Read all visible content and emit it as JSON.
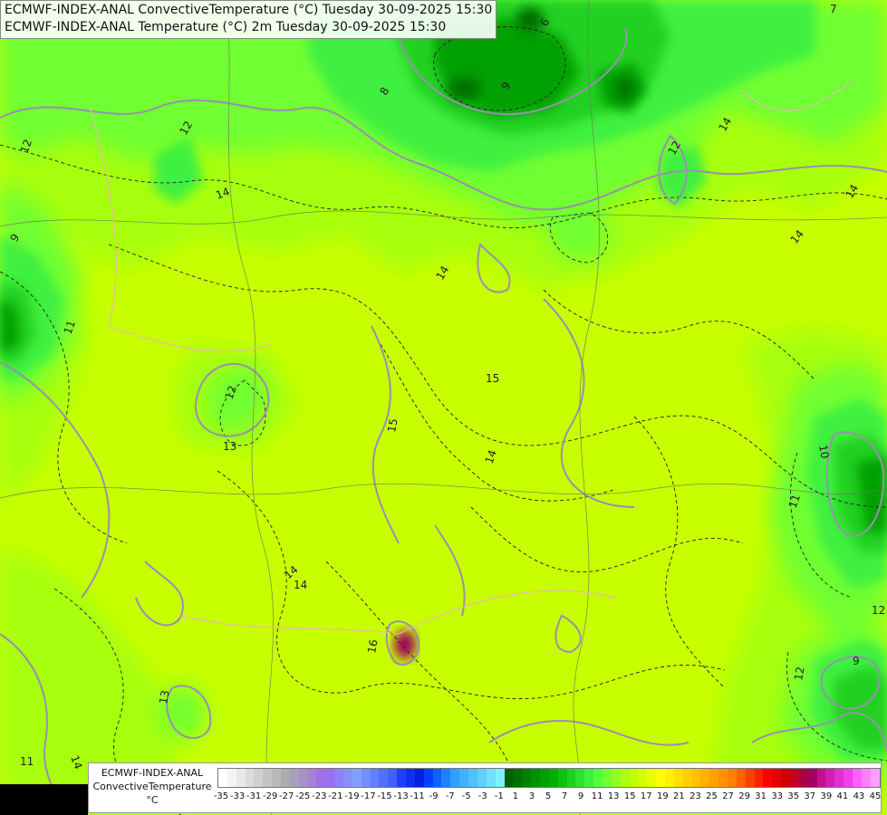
{
  "titles": {
    "line1": "ECMWF-INDEX-ANAL ConvectiveTemperature (°C) Tuesday 30-09-2025 15:30",
    "line2": "ECMWF-INDEX-ANAL Temperature (°C) 2m Tuesday 30-09-2025 15:30"
  },
  "legend": {
    "line1": "ECMWF-INDEX-ANAL",
    "line2": "ConvectiveTemperature",
    "line3": "°C",
    "tick_labels": [
      "-35",
      "-33",
      "-31",
      "-29",
      "-27",
      "-25",
      "-23",
      "-21",
      "-19",
      "-17",
      "-15",
      "-13",
      "-11",
      "-9",
      "-7",
      "-5",
      "-3",
      "-1",
      "1",
      "3",
      "5",
      "7",
      "9",
      "11",
      "13",
      "15",
      "17",
      "19",
      "21",
      "23",
      "25",
      "27",
      "29",
      "31",
      "33",
      "35",
      "37",
      "39",
      "41",
      "43",
      "45"
    ],
    "colors": [
      "#ffffff",
      "#f4f4f4",
      "#e8e8e8",
      "#dcdcdc",
      "#d0d0d0",
      "#c4c4c4",
      "#b8b8b8",
      "#acacac",
      "#a8a0b8",
      "#a890c8",
      "#a880d8",
      "#a070e8",
      "#9870f0",
      "#9080f8",
      "#8890f8",
      "#80a0ff",
      "#7090ff",
      "#6080ff",
      "#5070ff",
      "#4060ff",
      "#2040ff",
      "#1030f0",
      "#0020e0",
      "#0040ff",
      "#1060ff",
      "#2080ff",
      "#30a0ff",
      "#40b0ff",
      "#50c0ff",
      "#60d0ff",
      "#70e0ff",
      "#80f0ff",
      "#006000",
      "#007000",
      "#008000",
      "#009000",
      "#00a000",
      "#00b000",
      "#10c010",
      "#20d020",
      "#30e030",
      "#40f040",
      "#50ff40",
      "#70ff30",
      "#90ff20",
      "#a8ff10",
      "#c0ff00",
      "#d4ff00",
      "#e8ff00",
      "#ffff00",
      "#fff000",
      "#ffe000",
      "#ffd000",
      "#ffc000",
      "#ffb000",
      "#ffa000",
      "#ff9000",
      "#ff8000",
      "#ff6000",
      "#ff4000",
      "#ff2000",
      "#ff0000",
      "#e80000",
      "#d00000",
      "#c00020",
      "#b00040",
      "#a00060",
      "#c01090",
      "#d020b0",
      "#e030d0",
      "#f040e8",
      "#ff60ff",
      "#ff80ff",
      "#ffa0ff"
    ]
  },
  "contour_labels": [
    {
      "text": "12"
    },
    {
      "text": "12"
    },
    {
      "text": "14"
    },
    {
      "text": "14"
    },
    {
      "text": "14"
    },
    {
      "text": "9"
    },
    {
      "text": "11"
    },
    {
      "text": "12"
    },
    {
      "text": "13"
    },
    {
      "text": "15"
    },
    {
      "text": "15"
    },
    {
      "text": "14"
    },
    {
      "text": "14"
    },
    {
      "text": "14"
    },
    {
      "text": "10"
    },
    {
      "text": "11"
    },
    {
      "text": "12"
    },
    {
      "text": "12"
    },
    {
      "text": "9"
    },
    {
      "text": "13"
    },
    {
      "text": "11"
    },
    {
      "text": "14"
    },
    {
      "text": "16"
    },
    {
      "text": "9"
    },
    {
      "text": "12"
    },
    {
      "text": "8"
    },
    {
      "text": "7"
    },
    {
      "text": "14"
    },
    {
      "text": "14"
    },
    {
      "text": "6"
    }
  ],
  "colors": {
    "base": "#c8ff00",
    "lime": "#a8ff10",
    "green_light": "#70ff30",
    "green": "#40f040",
    "green_mid": "#20d020",
    "green_dark": "#00a000",
    "green_darker": "#007000",
    "contour_gray": "#9a8fb0",
    "contour_dash": "#222222",
    "border_pink": "#f0b0c0",
    "river": "#6a7a5a"
  }
}
